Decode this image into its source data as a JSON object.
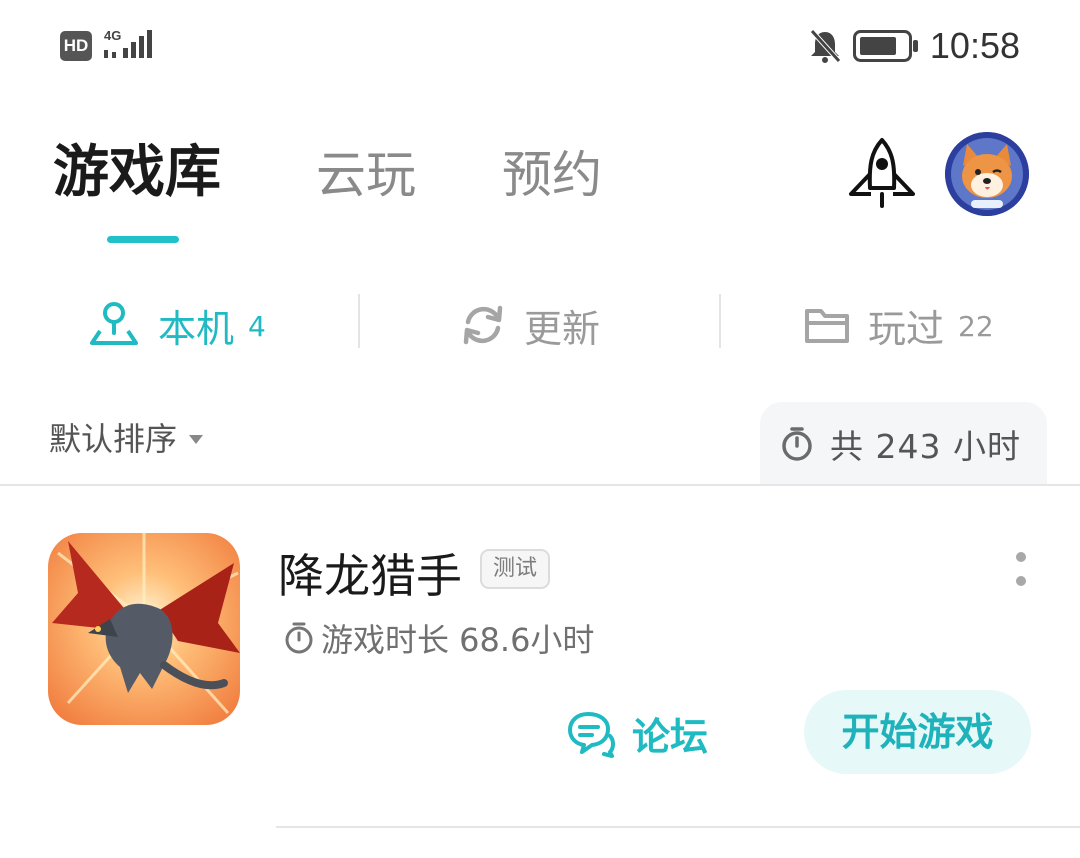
{
  "status_bar": {
    "hd": "HD",
    "network": "4G",
    "time": "10:58",
    "icons": [
      "signal-icon",
      "bell-off-icon",
      "battery-icon"
    ]
  },
  "header": {
    "tabs": [
      {
        "label": "游戏库",
        "active": true
      },
      {
        "label": "云玩",
        "active": false
      },
      {
        "label": "预约",
        "active": false
      }
    ],
    "icons": [
      "rocket-icon",
      "avatar"
    ]
  },
  "segments": {
    "local": {
      "label": "本机",
      "count": "4",
      "icon": "location-pin-icon"
    },
    "update": {
      "label": "更新",
      "icon": "refresh-icon"
    },
    "played": {
      "label": "玩过",
      "count": "22",
      "icon": "folder-icon"
    }
  },
  "sort": {
    "label": "默认排序",
    "total_time": "共 243 小时"
  },
  "games": [
    {
      "title": "降龙猎手",
      "tag": "测试",
      "play_time": "游戏时长 68.6小时",
      "forum_label": "论坛",
      "start_label": "开始游戏"
    }
  ],
  "colors": {
    "accent": "#20c1c8",
    "start_button_bg": "#e7f8f9",
    "muted_text": "#8a8a8a"
  }
}
